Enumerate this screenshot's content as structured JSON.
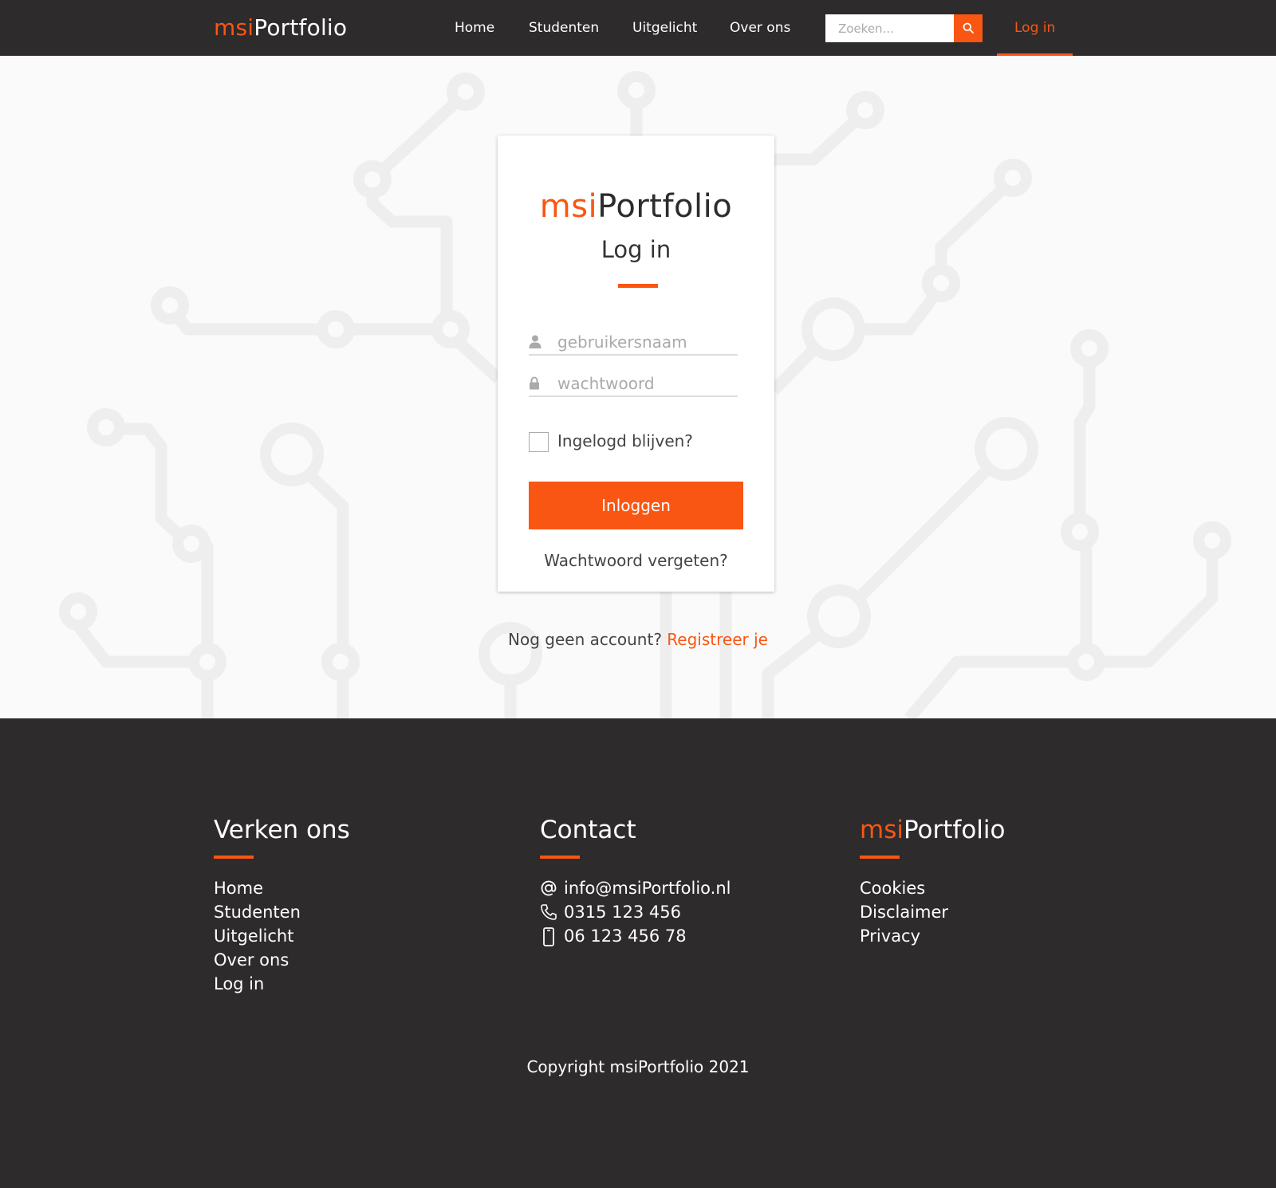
{
  "header": {
    "logo_prefix": "msi",
    "logo_suffix": "Portfolio",
    "nav": [
      {
        "label": "Home"
      },
      {
        "label": "Studenten"
      },
      {
        "label": "Uitgelicht"
      },
      {
        "label": "Over ons"
      }
    ],
    "search_placeholder": "Zoeken...",
    "login_label": "Log in"
  },
  "login_card": {
    "logo_prefix": "msi",
    "logo_suffix": "Portfolio",
    "title": "Log in",
    "username_placeholder": "gebruikersnaam",
    "password_placeholder": "wachtwoord",
    "remember_label": "Ingelogd blijven?",
    "remember_checked": false,
    "submit_label": "Inloggen",
    "forgot_label": "Wachtwoord vergeten?"
  },
  "register": {
    "prompt": "Nog geen account?",
    "link": "Registreer je"
  },
  "footer": {
    "explore": {
      "title": "Verken ons",
      "links": [
        "Home",
        "Studenten",
        "Uitgelicht",
        "Over ons",
        "Log in"
      ]
    },
    "contact": {
      "title": "Contact",
      "email": "info@msiPortfolio.nl",
      "phone": "0315 123 456",
      "mobile": "06 123 456 78"
    },
    "brand": {
      "title_prefix": "msi",
      "title_suffix": "Portfolio",
      "links": [
        "Cookies",
        "Disclaimer",
        "Privacy"
      ]
    },
    "copyright": "Copyright msiPortfolio 2021"
  },
  "colors": {
    "accent": "#f95613",
    "dark": "#2d2b2c",
    "background": "#fafafa"
  }
}
